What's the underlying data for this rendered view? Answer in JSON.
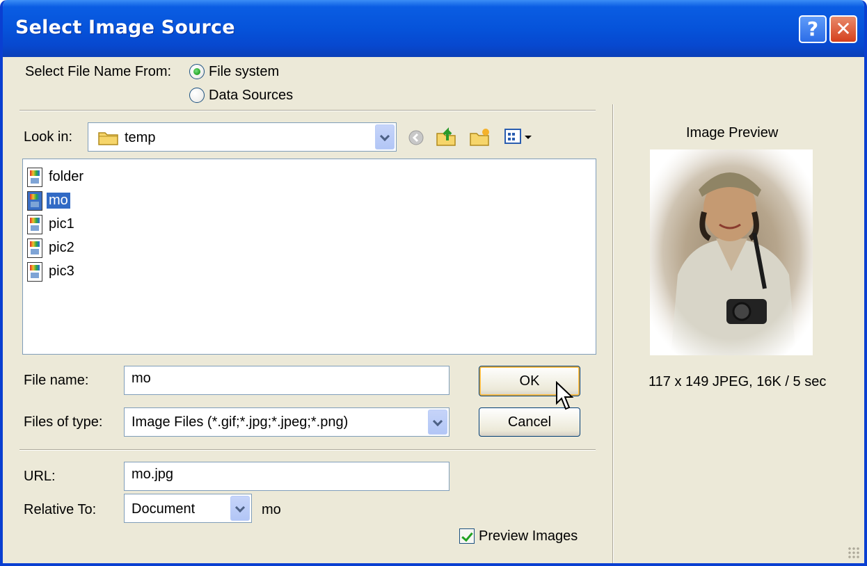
{
  "window": {
    "title": "Select Image Source",
    "help_glyph": "?",
    "close_glyph": "✕"
  },
  "source": {
    "label": "Select File Name From:",
    "options": [
      "File system",
      "Data Sources"
    ],
    "selected": "File system"
  },
  "lookin": {
    "label": "Look in:",
    "value": "temp"
  },
  "files": [
    {
      "name": "folder",
      "selected": false
    },
    {
      "name": "mo",
      "selected": true
    },
    {
      "name": "pic1",
      "selected": false
    },
    {
      "name": "pic2",
      "selected": false
    },
    {
      "name": "pic3",
      "selected": false
    }
  ],
  "filename": {
    "label": "File name:",
    "value": "mo"
  },
  "filetype": {
    "label": "Files of type:",
    "value": "Image Files (*.gif;*.jpg;*.jpeg;*.png)"
  },
  "buttons": {
    "ok": "OK",
    "cancel": "Cancel"
  },
  "url": {
    "label": "URL:",
    "value": "mo.jpg"
  },
  "relative": {
    "label": "Relative To:",
    "value": "Document",
    "target": "mo"
  },
  "preview_images": {
    "label": "Preview Images",
    "checked": true
  },
  "preview": {
    "heading": "Image Preview",
    "info": "117 x 149 JPEG, 16K / 5 sec"
  },
  "colors": {
    "titlebar": "#0653da",
    "dialog_bg": "#ece9d8",
    "selection": "#316ac5",
    "radio_checked": "#21a121"
  }
}
